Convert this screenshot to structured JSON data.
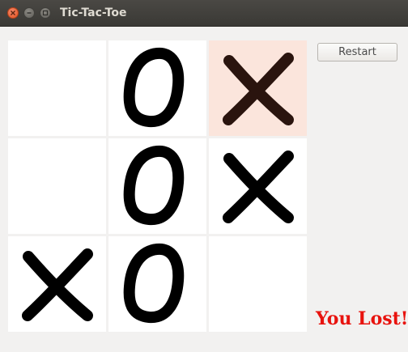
{
  "window": {
    "title": "Tic-Tac-Toe"
  },
  "board": {
    "cells": [
      "",
      "O",
      "X",
      "",
      "O",
      "X",
      "X",
      "O",
      ""
    ],
    "highlighted_cell": 2,
    "colors": {
      "cell_background": "#ffffff",
      "highlight_background": "#fbe5dc",
      "mark": "#000000",
      "highlight_mark": "#2a140e"
    }
  },
  "controls": {
    "restart_label": "Restart"
  },
  "status": {
    "message": "You Lost!",
    "color": "#e8130e"
  }
}
